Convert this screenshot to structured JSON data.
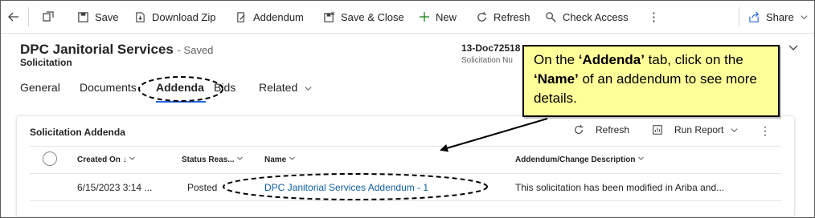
{
  "toolbar": {
    "back_icon": "back-arrow-icon",
    "save_label": "Save",
    "download_zip_label": "Download Zip",
    "addendum_label": "Addendum",
    "save_close_label": "Save & Close",
    "new_label": "New",
    "refresh_label": "Refresh",
    "check_access_label": "Check Access",
    "more_label": "⋮",
    "share_label": "Share"
  },
  "header": {
    "title": "DPC Janitorial Services",
    "saved_status": "- Saved",
    "entity": "Solicitation",
    "field_value": "13-Doc72518",
    "field_label": "Solicitation Nu"
  },
  "tabs": [
    {
      "label": "General"
    },
    {
      "label": "Documents"
    },
    {
      "label": "Addenda"
    },
    {
      "label": "Bids"
    },
    {
      "label": "Related"
    }
  ],
  "subgrid": {
    "title": "Solicitation Addenda",
    "refresh_label": "Refresh",
    "run_report_label": "Run Report",
    "columns": [
      {
        "label": "Created On ↓"
      },
      {
        "label": "Status Reas..."
      },
      {
        "label": "Name"
      },
      {
        "label": "Addendum/Change Description"
      }
    ],
    "rows": [
      {
        "created_on": "6/15/2023 3:14 ...",
        "status": "Posted",
        "name": "DPC Janitorial Services Addendum - 1",
        "description": "This solicitation has been modified in Ariba and..."
      }
    ]
  },
  "callout": {
    "part1": "On the ",
    "bold1": "‘Addenda’",
    "part2": " tab, click on the ",
    "bold2": "‘Name’",
    "part3": " of an addendum to see more details."
  },
  "colors": {
    "accent": "#2266e3",
    "link": "#115ea3",
    "callout_bg": "#ffff99"
  }
}
